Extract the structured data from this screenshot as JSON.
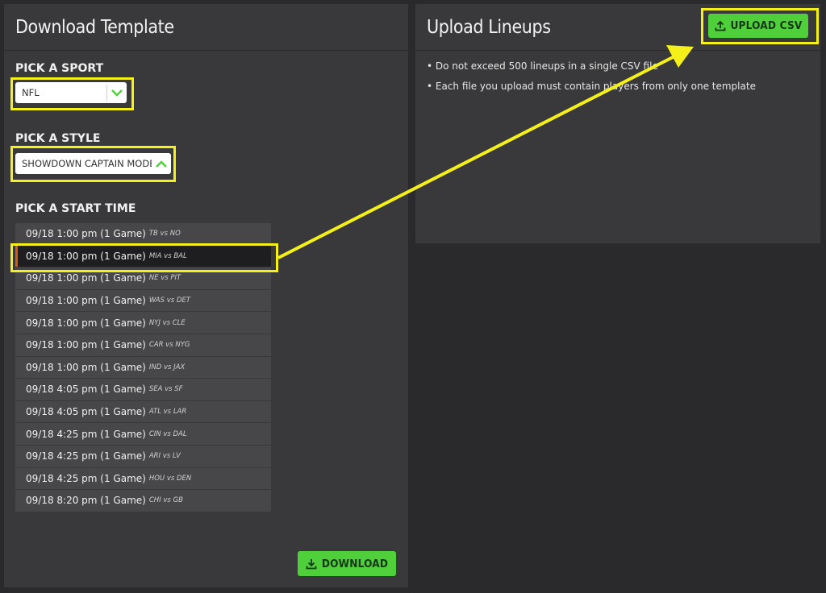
{
  "download_panel": {
    "title": "Download Template",
    "sport_label": "PICK A SPORT",
    "sport_value": "NFL",
    "style_label": "PICK A STYLE",
    "style_value": "SHOWDOWN CAPTAIN MODE",
    "start_time_label": "PICK A START TIME",
    "start_times": [
      {
        "time": "09/18 1:00 pm (1 Game)",
        "match": "TB vs NO",
        "selected": false
      },
      {
        "time": "09/18 1:00 pm (1 Game)",
        "match": "MIA vs BAL",
        "selected": true
      },
      {
        "time": "09/18 1:00 pm (1 Game)",
        "match": "NE vs PIT",
        "selected": false
      },
      {
        "time": "09/18 1:00 pm (1 Game)",
        "match": "WAS vs DET",
        "selected": false
      },
      {
        "time": "09/18 1:00 pm (1 Game)",
        "match": "NYJ vs CLE",
        "selected": false
      },
      {
        "time": "09/18 1:00 pm (1 Game)",
        "match": "CAR vs NYG",
        "selected": false
      },
      {
        "time": "09/18 1:00 pm (1 Game)",
        "match": "IND vs JAX",
        "selected": false
      },
      {
        "time": "09/18 4:05 pm (1 Game)",
        "match": "SEA vs SF",
        "selected": false
      },
      {
        "time": "09/18 4:05 pm (1 Game)",
        "match": "ATL vs LAR",
        "selected": false
      },
      {
        "time": "09/18 4:25 pm (1 Game)",
        "match": "CIN vs DAL",
        "selected": false
      },
      {
        "time": "09/18 4:25 pm (1 Game)",
        "match": "ARI vs LV",
        "selected": false
      },
      {
        "time": "09/18 4:25 pm (1 Game)",
        "match": "HOU vs DEN",
        "selected": false
      },
      {
        "time": "09/18 8:20 pm (1 Game)",
        "match": "CHI vs GB",
        "selected": false
      }
    ],
    "download_label": "DOWNLOAD",
    "download_icon": "download-icon"
  },
  "upload_panel": {
    "title": "Upload Lineups",
    "upload_label": "UPLOAD CSV",
    "upload_icon": "upload-icon",
    "notes": [
      "• Do not exceed 500 lineups in a single CSV file",
      "• Each file you upload must contain players from only one template"
    ]
  },
  "colors": {
    "background": "#2a2a2c",
    "panel": "#39393b",
    "accent_green": "#4fcf3a",
    "highlight_yellow": "#f5f01a",
    "selected_marker": "#d35b16"
  }
}
